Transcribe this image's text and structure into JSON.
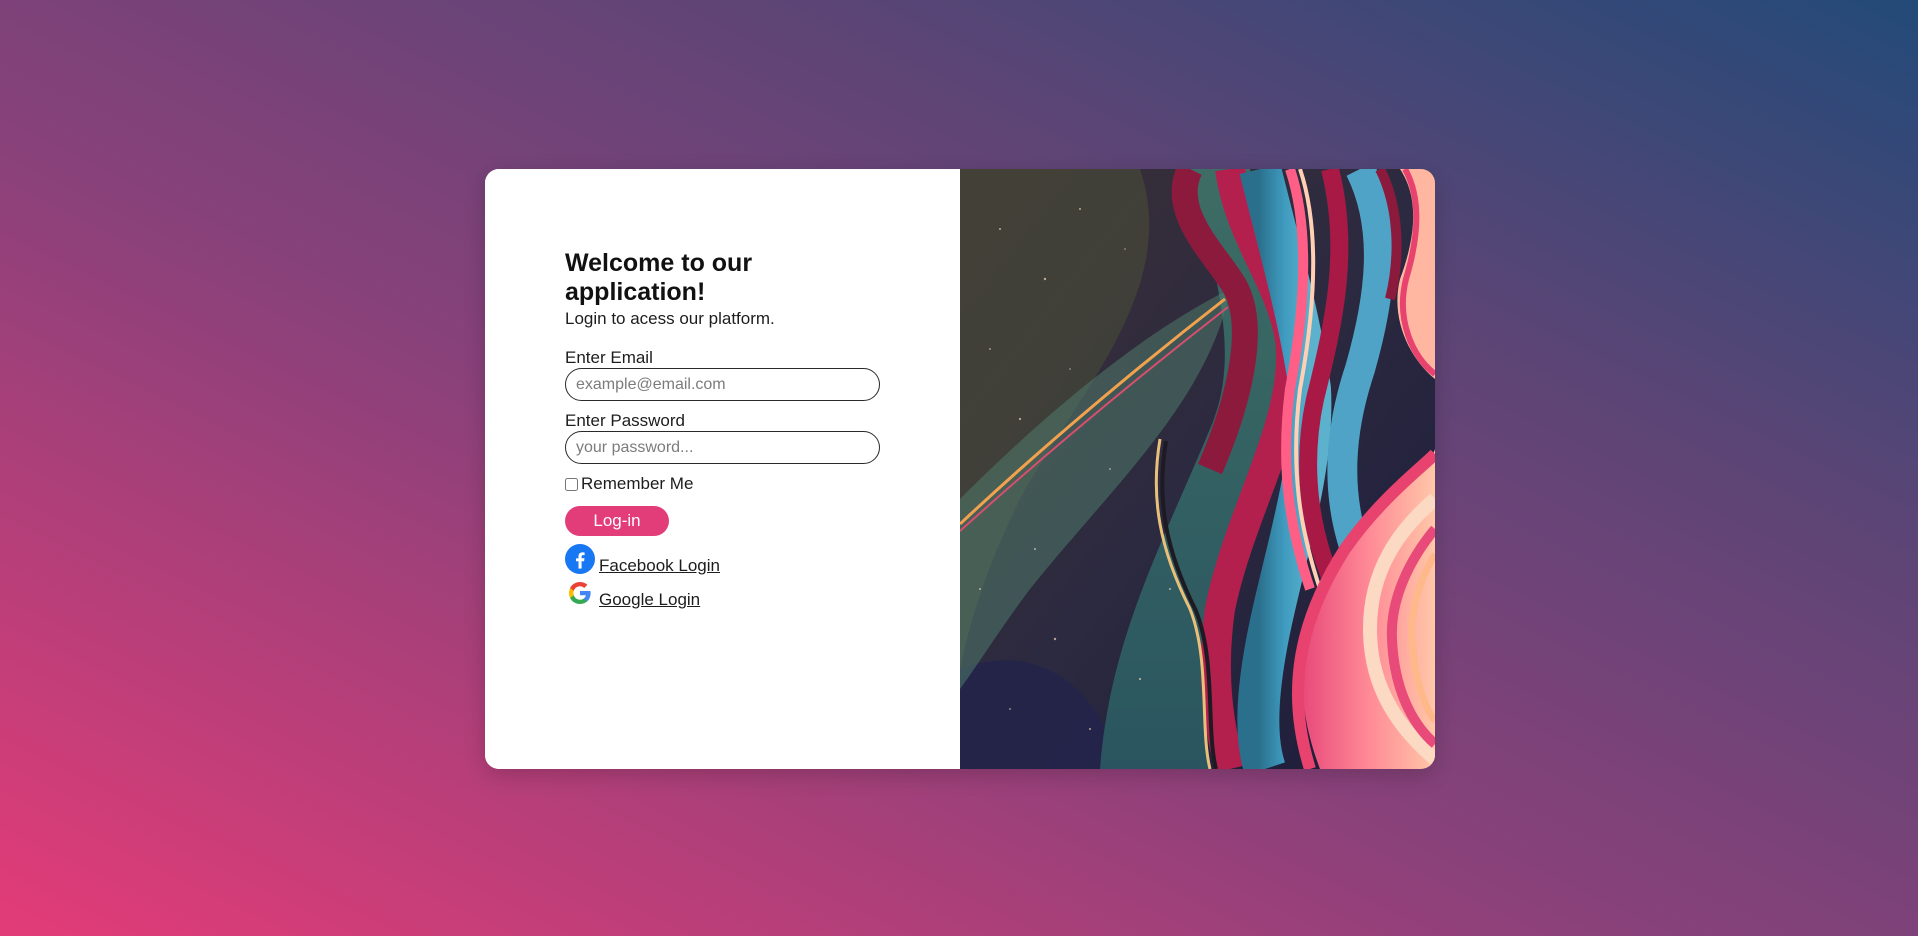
{
  "login": {
    "title": "Welcome to our application!",
    "subtitle": "Login to acess our platform.",
    "email_label": "Enter Email",
    "email_placeholder": "example@email.com",
    "password_label": "Enter Password",
    "password_placeholder": "your password...",
    "remember_label": "Remember Me",
    "login_button": "Log-in",
    "facebook_link": "Facebook Login",
    "google_link": "Google Login"
  },
  "icons": {
    "facebook": "facebook-icon",
    "google": "google-icon"
  },
  "colors": {
    "accent": "#e23d78",
    "facebook": "#1877f2",
    "background_start": "#e33c78",
    "background_end": "#234a78"
  }
}
